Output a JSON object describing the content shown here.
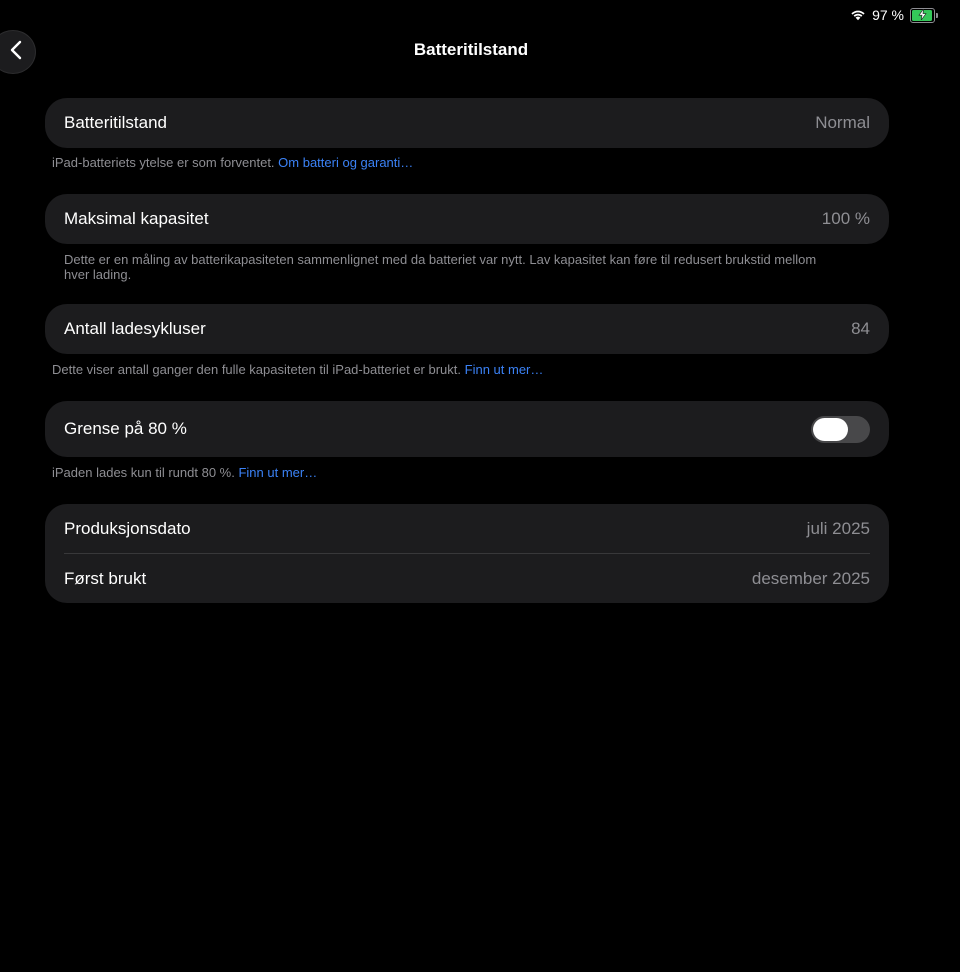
{
  "status_bar": {
    "battery_percent": "97 %",
    "battery_level": 0.97,
    "charging": true,
    "wifi_icon": "wifi-icon",
    "battery_icon": "battery-charging-icon",
    "battery_color": "#34c759"
  },
  "nav": {
    "back_icon": "chevron-left-icon",
    "title": "Batteritilstand"
  },
  "health": {
    "label": "Batteritilstand",
    "value": "Normal",
    "footnote_text": "iPad-batteriets ytelse er som forventet.",
    "footnote_link": "Om batteri og garanti…"
  },
  "capacity": {
    "label": "Maksimal kapasitet",
    "value": "100 %",
    "footnote_text": "Dette er en måling av batterikapasiteten sammenlignet med da batteriet var nytt. Lav kapasitet kan føre til redusert brukstid mellom hver lading."
  },
  "cycles": {
    "label": "Antall ladesykluser",
    "value": "84",
    "footnote_text": "Dette viser antall ganger den fulle kapasiteten til iPad-batteriet er brukt.",
    "footnote_link": "Finn ut mer…"
  },
  "limit": {
    "label": "Grense på 80 %",
    "toggle_on": false,
    "footnote_text": "iPaden lades kun til rundt 80 %.",
    "footnote_link": "Finn ut mer…"
  },
  "dates": {
    "manufacture_label": "Produksjonsdato",
    "manufacture_value": "juli 2025",
    "first_use_label": "Først brukt",
    "first_use_value": "desember 2025"
  },
  "colors": {
    "background": "#000000",
    "card": "#1c1c1e",
    "secondary_text": "#8e8e93",
    "link": "#3b82f6"
  }
}
